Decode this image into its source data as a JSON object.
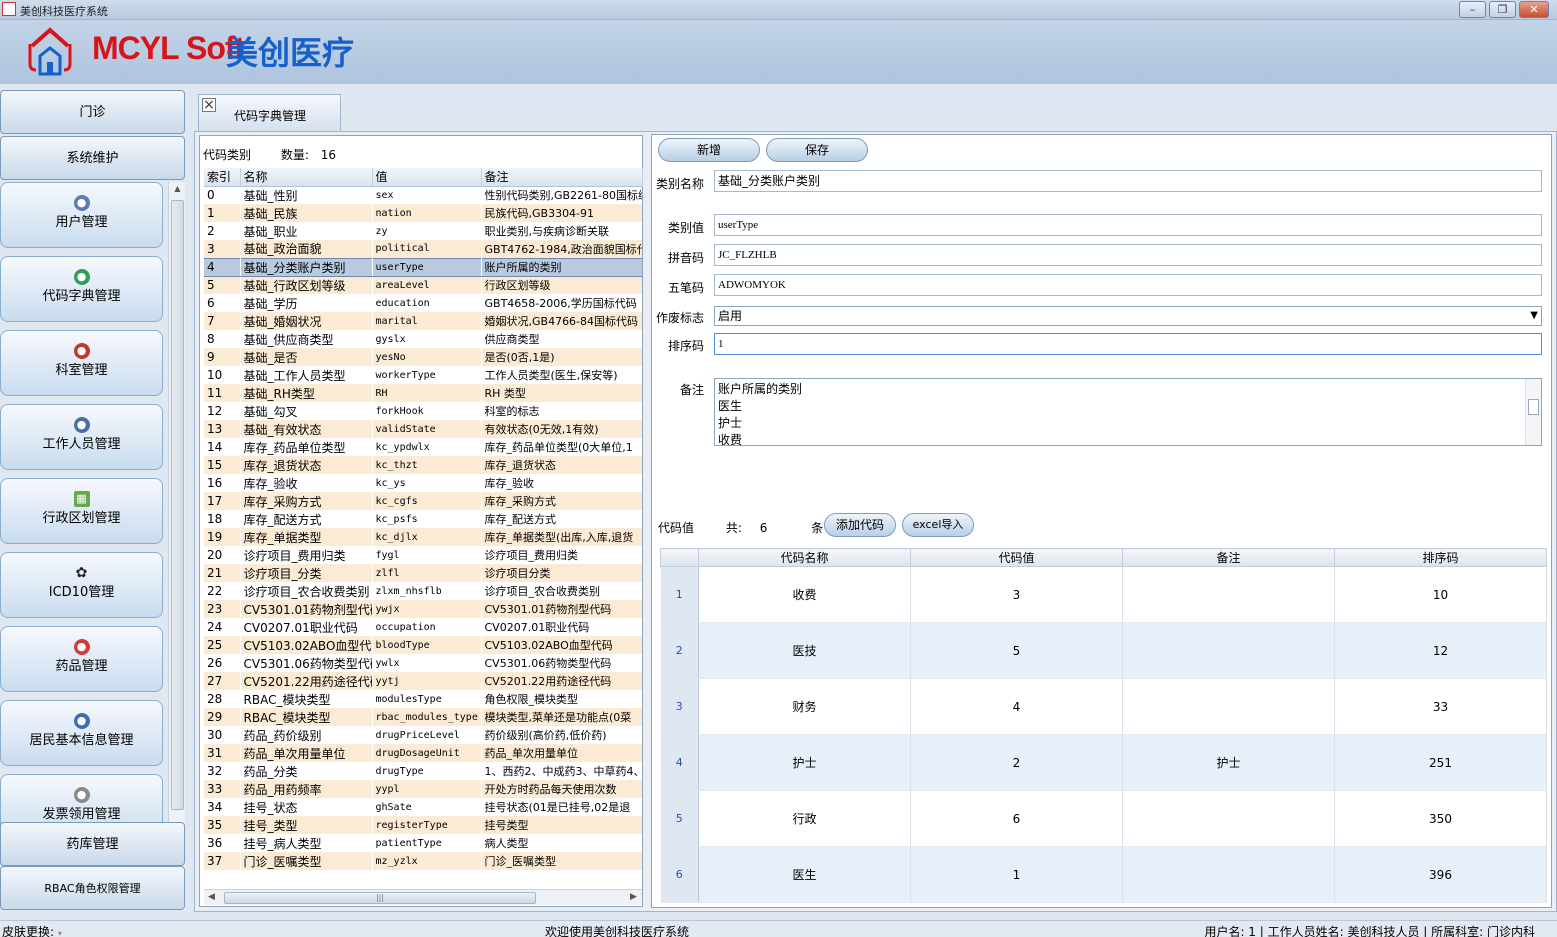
{
  "window": {
    "title": "美创科技医疗系统"
  },
  "brand": {
    "name_en": "MCYL Soft",
    "name_cn": "美创医疗",
    "colors": {
      "red": "#d8141b",
      "blue": "#1560c9"
    }
  },
  "nav": {
    "groups": [
      "门诊",
      "系统维护",
      "药库管理",
      "RBAC角色权限管理"
    ],
    "items": [
      {
        "label": "用户管理",
        "icon": "user-icon"
      },
      {
        "label": "代码字典管理",
        "icon": "dictionary-icon"
      },
      {
        "label": "科室管理",
        "icon": "department-icon"
      },
      {
        "label": "工作人员管理",
        "icon": "staff-icon"
      },
      {
        "label": "行政区划管理",
        "icon": "map-icon"
      },
      {
        "label": "ICD10管理",
        "icon": "icd-icon"
      },
      {
        "label": "药品管理",
        "icon": "medicine-icon"
      },
      {
        "label": "居民基本信息管理",
        "icon": "resident-icon"
      },
      {
        "label": "发票领用管理",
        "icon": "invoice-icon"
      }
    ]
  },
  "tab": {
    "label": "代码字典管理"
  },
  "category": {
    "label": "代码类别",
    "count_label": "数量:",
    "count": "16",
    "columns": [
      "索引",
      "名称",
      "值",
      "备注"
    ],
    "selected_index": 4,
    "rows": [
      [
        "0",
        "基础_性别",
        "sex",
        "性别代码类别,GB2261-80国标编"
      ],
      [
        "1",
        "基础_民族",
        "nation",
        "民族代码,GB3304-91"
      ],
      [
        "2",
        "基础_职业",
        "zy",
        "职业类别,与疾病诊断关联"
      ],
      [
        "3",
        "基础_政治面貌",
        "political",
        "GBT4762-1984,政治面貌国标代"
      ],
      [
        "4",
        "基础_分类账户类别",
        "userType",
        "账户所属的类别"
      ],
      [
        "5",
        "基础_行政区划等级",
        "areaLevel",
        "行政区划等级"
      ],
      [
        "6",
        "基础_学历",
        "education",
        "GBT4658-2006,学历国标代码"
      ],
      [
        "7",
        "基础_婚姻状况",
        "marital",
        "婚姻状况,GB4766-84国标代码"
      ],
      [
        "8",
        "基础_供应商类型",
        "gyslx",
        "供应商类型"
      ],
      [
        "9",
        "基础_是否",
        "yesNo",
        "是否(0否,1是)"
      ],
      [
        "10",
        "基础_工作人员类型",
        "workerType",
        "工作人员类型(医生,保安等)"
      ],
      [
        "11",
        "基础_RH类型",
        "RH",
        "RH 类型"
      ],
      [
        "12",
        "基础_勾叉",
        "forkHook",
        "科室的标志"
      ],
      [
        "13",
        "基础_有效状态",
        "validState",
        "有效状态(0无效,1有效)"
      ],
      [
        "14",
        "库存_药品单位类型",
        "kc_ypdwlx",
        "库存_药品单位类型(0大单位,1"
      ],
      [
        "15",
        "库存_退货状态",
        "kc_thzt",
        "库存_退货状态"
      ],
      [
        "16",
        "库存_验收",
        "kc_ys",
        "库存_验收"
      ],
      [
        "17",
        "库存_采购方式",
        "kc_cgfs",
        "库存_采购方式"
      ],
      [
        "18",
        "库存_配送方式",
        "kc_psfs",
        "库存_配送方式"
      ],
      [
        "19",
        "库存_单据类型",
        "kc_djlx",
        "库存_单据类型(出库,入库,退货"
      ],
      [
        "20",
        "诊疗项目_费用归类",
        "fygl",
        "诊疗项目_费用归类"
      ],
      [
        "21",
        "诊疗项目_分类",
        "zlfl",
        "诊疗项目分类"
      ],
      [
        "22",
        "诊疗项目_农合收费类别",
        "zlxm_nhsflb",
        "诊疗项目_农合收费类别"
      ],
      [
        "23",
        "CV5301.01药物剂型代码",
        "ywjx",
        "CV5301.01药物剂型代码"
      ],
      [
        "24",
        "CV0207.01职业代码",
        "occupation",
        "CV0207.01职业代码"
      ],
      [
        "25",
        "CV5103.02ABO血型代码",
        "bloodType",
        "CV5103.02ABO血型代码"
      ],
      [
        "26",
        "CV5301.06药物类型代码",
        "ywlx",
        "CV5301.06药物类型代码"
      ],
      [
        "27",
        "CV5201.22用药途径代码",
        "yytj",
        "CV5201.22用药途径代码"
      ],
      [
        "28",
        "RBAC_模块类型",
        "modulesType",
        "角色权限_模块类型"
      ],
      [
        "29",
        "RBAC_模块类型",
        "rbac_modules_type",
        "模块类型,菜单还是功能点(0菜"
      ],
      [
        "30",
        "药品_药价级别",
        "drugPriceLevel",
        "药价级别(高价药,低价药)"
      ],
      [
        "31",
        "药品_单次用量单位",
        "drugDosageUnit",
        "药品_单次用量单位"
      ],
      [
        "32",
        "药品_分类",
        "drugType",
        "1、西药2、中成药3、中草药4、"
      ],
      [
        "33",
        "药品_用药频率",
        "yypl",
        "开处方时药品每天使用次数"
      ],
      [
        "34",
        "挂号_状态",
        "ghSate",
        "挂号状态(01是已挂号,02是退"
      ],
      [
        "35",
        "挂号_类型",
        "registerType",
        "挂号类型"
      ],
      [
        "36",
        "挂号_病人类型",
        "patientType",
        "病人类型"
      ],
      [
        "37",
        "门诊_医嘱类型",
        "mz_yzlx",
        "门诊_医嘱类型"
      ]
    ]
  },
  "detail": {
    "add_label": "新增",
    "save_label": "保存",
    "fields": {
      "category_name_label": "类别名称",
      "category_name": "基础_分类账户类别",
      "category_value_label": "类别值",
      "category_value": "userType",
      "pinyin_label": "拼音码",
      "pinyin": "JC_FLZHLB",
      "wubi_label": "五笔码",
      "wubi": "ADWOMYOK",
      "status_label": "作废标志",
      "status": "启用",
      "sort_label": "排序码",
      "sort": "1",
      "memo_label": "备注",
      "memo_lines": [
        "账户所属的类别",
        "医生",
        "护士",
        "收费"
      ]
    },
    "codes": {
      "label": "代码值",
      "total_prefix": "共:",
      "total": "6",
      "total_suffix": "条",
      "add_code_label": "添加代码",
      "excel_label": "excel导入",
      "columns": [
        "代码名称",
        "代码值",
        "备注",
        "排序码"
      ],
      "rows": [
        [
          "1",
          "收费",
          "3",
          "",
          "10"
        ],
        [
          "2",
          "医技",
          "5",
          "",
          "12"
        ],
        [
          "3",
          "财务",
          "4",
          "",
          "33"
        ],
        [
          "4",
          "护士",
          "2",
          "护士",
          "251"
        ],
        [
          "5",
          "行政",
          "6",
          "",
          "350"
        ],
        [
          "6",
          "医生",
          "1",
          "",
          "396"
        ]
      ]
    }
  },
  "status": {
    "skin_label": "皮肤更换:",
    "welcome": "欢迎使用美创科技医疗系统",
    "user_info": "用户名: 1 | 工作人员姓名: 美创科技人员 | 所属科室: 门诊内科"
  }
}
